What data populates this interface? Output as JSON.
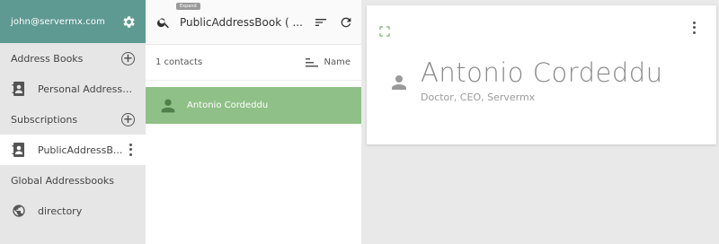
{
  "sidebar": {
    "user_email": "john@servermx.com",
    "address_books_header": "Address Books",
    "personal_book": "Personal Address ...",
    "subscriptions_header": "Subscriptions",
    "subscription_book": "PublicAddressB...",
    "global_header": "Global Addressbooks",
    "global_book": "directory"
  },
  "middle": {
    "tooltip": "Expand",
    "book_title": "PublicAddressBook ( ...",
    "count": "1 contacts",
    "sort_label": "Name",
    "contacts": [
      {
        "name": "Antonio Cordeddu"
      }
    ]
  },
  "card": {
    "name": "Antonio Cordeddu",
    "subtitle": "Doctor, CEO, Servermx"
  },
  "colors": {
    "header_teal": "#5f9a92",
    "selected_green": "#8fc087"
  }
}
